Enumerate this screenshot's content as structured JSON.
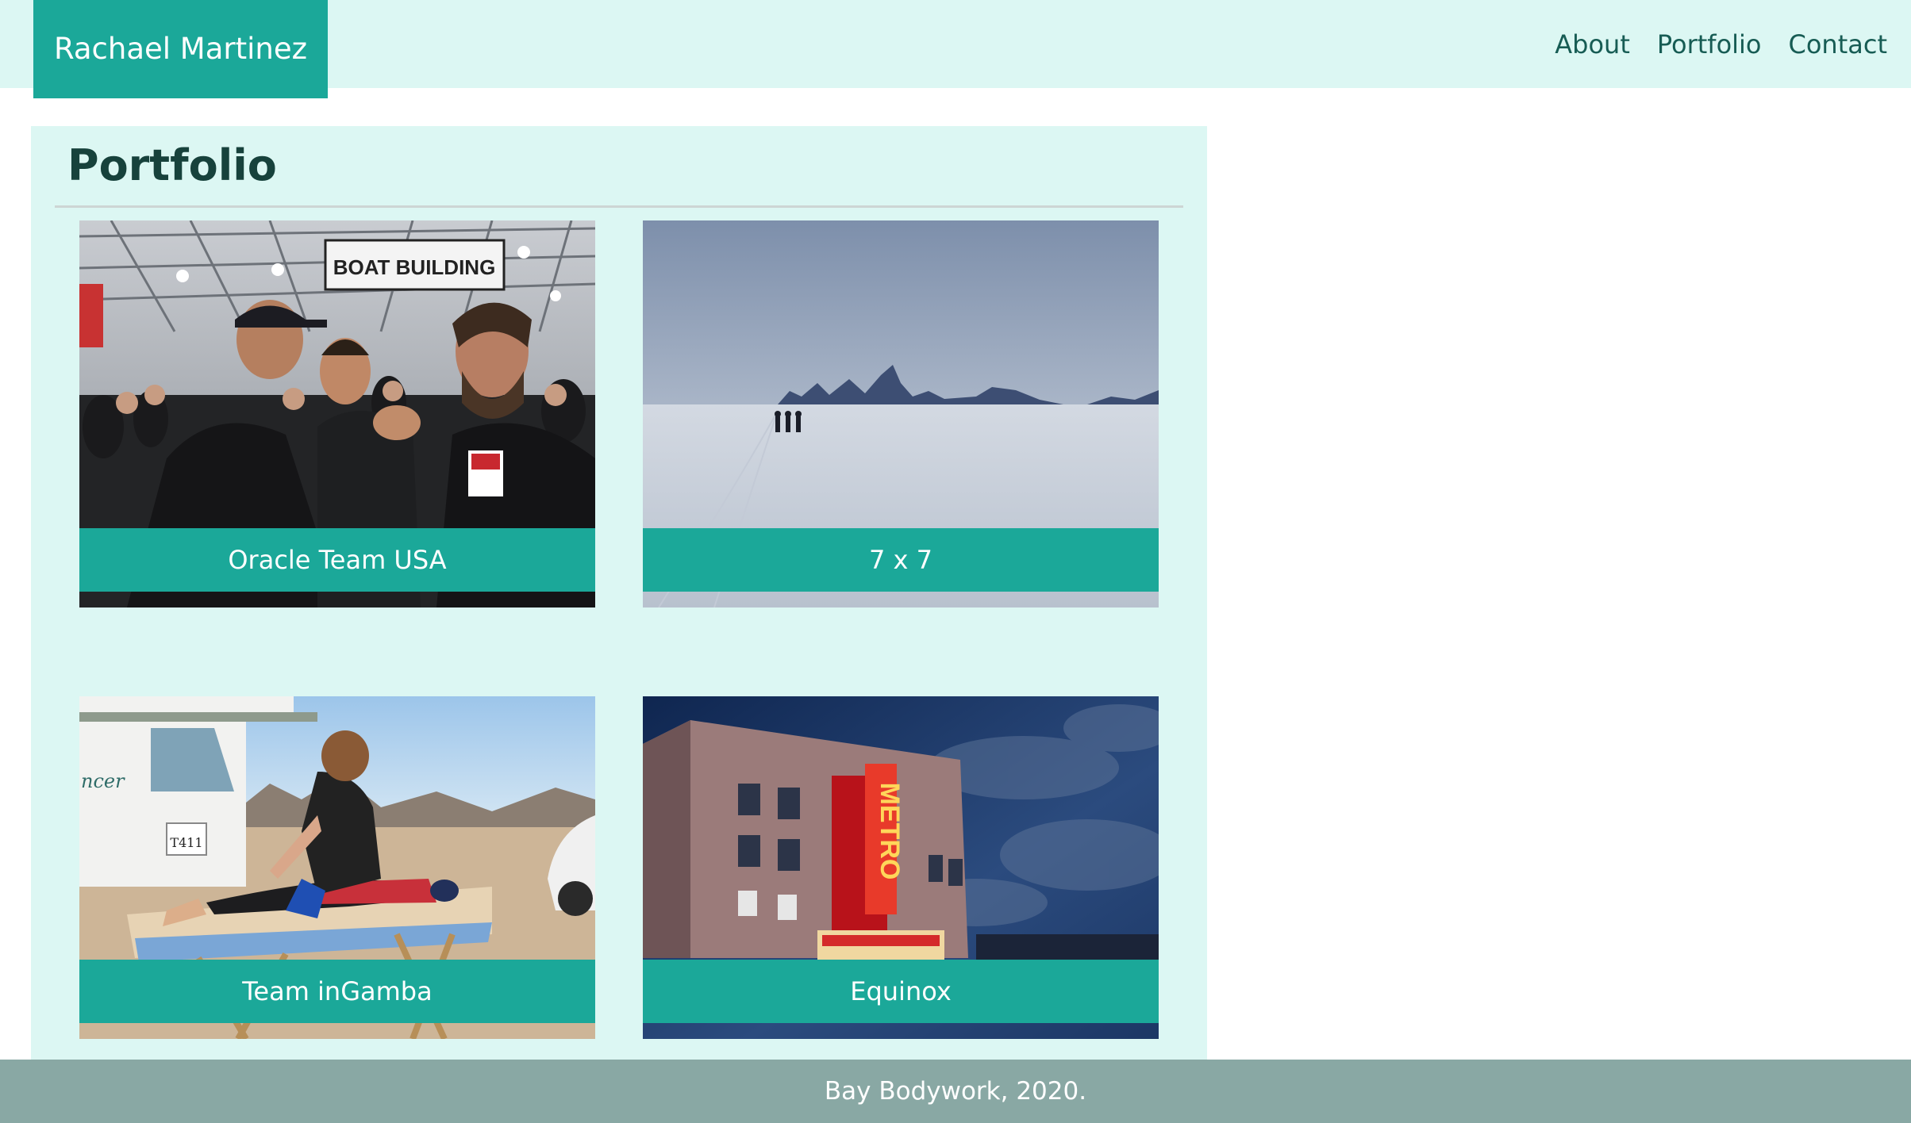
{
  "header": {
    "brand": "Rachael Martinez",
    "nav": [
      "About",
      "Portfolio",
      "Contact"
    ]
  },
  "main": {
    "title": "Portfolio",
    "items": [
      {
        "caption": "Oracle Team USA",
        "sign_text": "BOAT BUILDING"
      },
      {
        "caption": "7 x 7"
      },
      {
        "caption": "Team inGamba",
        "plate_text": "T411",
        "rv_text": "ncer"
      },
      {
        "caption": "Equinox",
        "sign_text": "METRO"
      }
    ]
  },
  "footer": {
    "text": "Bay Bodywork, 2020."
  },
  "colors": {
    "header_bg": "#dcf7f3",
    "accent": "#1ba899",
    "nav_text": "#175c54",
    "title_text": "#17423c",
    "footer_bg": "#89a8a4"
  }
}
